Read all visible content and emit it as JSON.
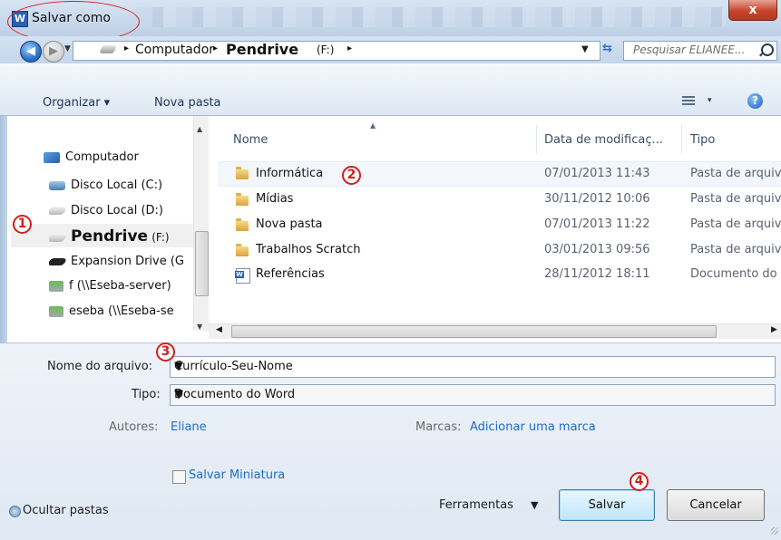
{
  "window": {
    "title": "Salvar como",
    "close_label": "x"
  },
  "address": {
    "segments": [
      "Computador",
      "Pendrive",
      "(F:)"
    ],
    "separator": "▸",
    "search_placeholder": "Pesquisar ELIANEE..."
  },
  "toolbar": {
    "organize_label": "Organizar ▾",
    "new_folder_label": "Nova pasta",
    "view_dd": "▾",
    "help": "?"
  },
  "nav": {
    "items": [
      {
        "label": "Computador",
        "icon": "computer-icon"
      },
      {
        "label": "Disco Local (C:)",
        "icon": "system-drive-icon"
      },
      {
        "label": "Disco Local (D:)",
        "icon": "drive-icon"
      },
      {
        "label": "Pendrive",
        "sublabel": "(F:)",
        "icon": "usb-drive-icon",
        "selected": true
      },
      {
        "label": "Expansion Drive (G",
        "icon": "external-drive-icon"
      },
      {
        "label": "f (\\\\Eseba-server)",
        "icon": "network-drive-icon"
      },
      {
        "label": "eseba (\\\\Eseba-se",
        "icon": "network-drive-icon"
      }
    ]
  },
  "files": {
    "columns": {
      "name": "Nome",
      "date": "Data de modificaç...",
      "type": "Tipo"
    },
    "rows": [
      {
        "name": "Informática",
        "date": "07/01/2013 11:43",
        "type": "Pasta de arquiv",
        "icon": "folder-icon"
      },
      {
        "name": "Mídias",
        "date": "30/11/2012 10:06",
        "type": "Pasta de arquiv",
        "icon": "folder-icon"
      },
      {
        "name": "Nova pasta",
        "date": "07/01/2013 11:22",
        "type": "Pasta de arquiv",
        "icon": "folder-icon"
      },
      {
        "name": "Trabalhos Scratch",
        "date": "03/01/2013 09:56",
        "type": "Pasta de arquiv",
        "icon": "folder-icon"
      },
      {
        "name": "Referências",
        "date": "28/11/2012 18:11",
        "type": "Documento do",
        "icon": "word-document-icon"
      }
    ]
  },
  "form": {
    "filename_label": "Nome do arquivo:",
    "filename_value": "Currículo-Seu-Nome",
    "type_label": "Tipo:",
    "type_value": "Documento do Word",
    "authors_label": "Autores:",
    "authors_value": "Eliane",
    "tags_label": "Marcas:",
    "tags_value": "Adicionar uma marca",
    "thumbnail_label": "Salvar Miniatura"
  },
  "footer": {
    "hide_folders": "Ocultar pastas",
    "tools": "Ferramentas",
    "save": "Salvar",
    "cancel": "Cancelar"
  },
  "annotations": {
    "one": "1",
    "two": "2",
    "three": "3",
    "four": "4"
  },
  "colors": {
    "annotation": "#d61d1d",
    "link": "#1e6bc9",
    "accent": "#3c7fb1"
  }
}
